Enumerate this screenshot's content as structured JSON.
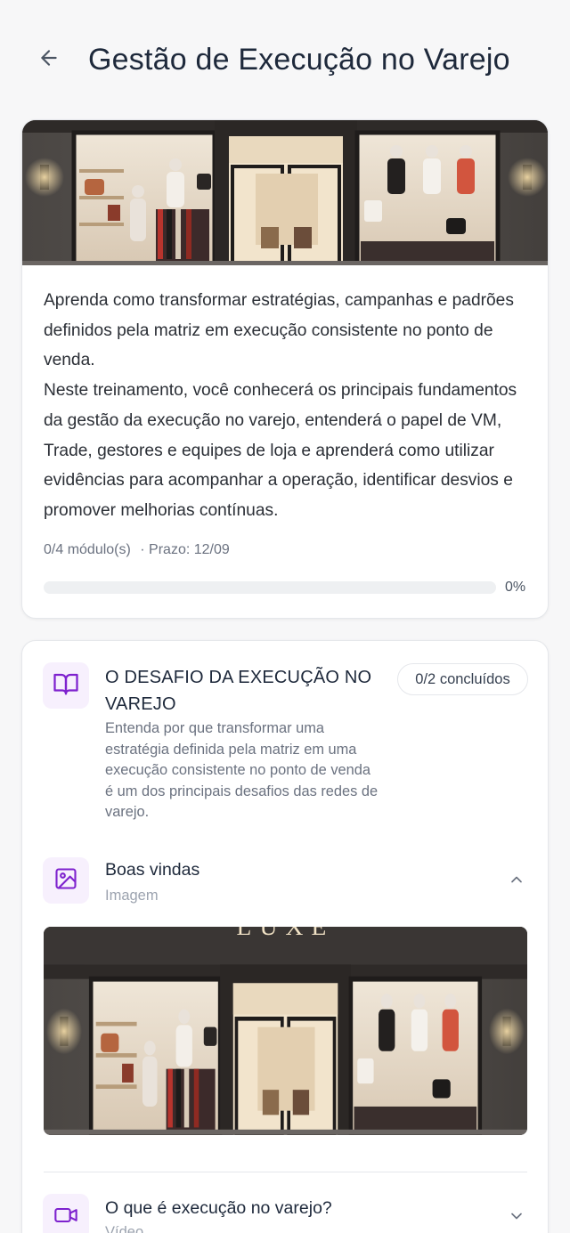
{
  "header": {
    "back_icon": "arrow-left-icon",
    "title": "Gestão de Execução no Varejo"
  },
  "course": {
    "cover_image": "storefront-photo",
    "description": [
      "Aprenda como transformar estratégias, campanhas e padrões definidos pela matriz em execução consistente no ponto de venda.",
      "Neste treinamento, você conhecerá os principais fundamentos da gestão da execução no varejo, entenderá o papel de VM, Trade, gestores e equipes de loja e aprenderá como utilizar evidências para acompanhar a operação, identificar desvios e promover melhorias contínuas."
    ],
    "modules_progress": "0/4 módulo(s)",
    "deadline": "· Prazo: 12/09",
    "progress_value": 0,
    "progress_label": "0%"
  },
  "module": {
    "icon": "book-open-icon",
    "title": "O DESAFIO DA EXECUÇÃO NO VAREJO",
    "subtitle": "Entenda por que transformar uma estratégia definida pela matriz em uma execução consistente no ponto de venda é um dos principais desafios das redes de varejo.",
    "completed_badge": "0/2 concluídos",
    "lessons": [
      {
        "icon": "image-icon",
        "title": "Boas vindas",
        "type": "Imagem",
        "expanded": true,
        "chevron": "chevron-up-icon"
      },
      {
        "icon": "video-icon",
        "title": "O que é execução no varejo?",
        "type": "Vídeo",
        "expanded": false,
        "chevron": "chevron-down-icon"
      }
    ],
    "lesson_image_sign": "LUXE"
  },
  "colors": {
    "accent": "#7e22ce",
    "accent_bg": "#f7f0fd",
    "background": "#f7f7f8",
    "text": "#1e293b",
    "muted": "#6b7280"
  }
}
